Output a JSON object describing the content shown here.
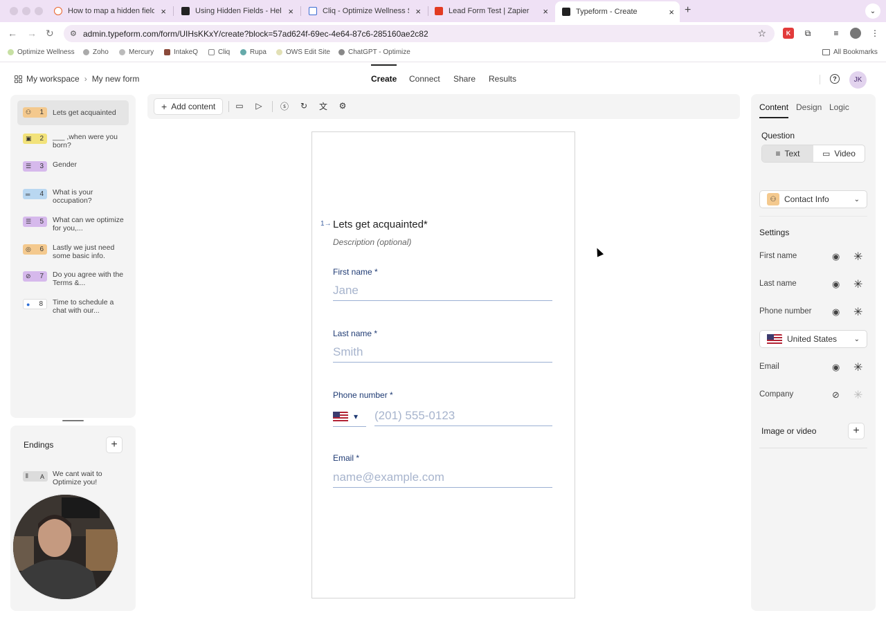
{
  "browser": {
    "tabs": [
      {
        "title": "How to map a hidden field in",
        "color": "#e8632b"
      },
      {
        "title": "Using Hidden Fields - Help Ce",
        "color": "#222222"
      },
      {
        "title": "Cliq - Optimize Wellness Solu",
        "color": "#3a6bd1"
      },
      {
        "title": "Lead Form Test | Zapier",
        "color": "#e23b22"
      },
      {
        "title": "Typeform - Create",
        "color": "#222222"
      }
    ],
    "url": "admin.typeform.com/form/UIHsKKxY/create?block=57ad624f-69ec-4e64-87c6-285160ae2c82",
    "bookmarks": [
      "Optimize Wellness",
      "Zoho",
      "Mercury",
      "IntakeQ",
      "Cliq",
      "Rupa",
      "OWS Edit Site",
      "ChatGPT - Optimize"
    ],
    "all_bookmarks": "All Bookmarks"
  },
  "header": {
    "workspace": "My workspace",
    "form_name": "My new form",
    "nav": [
      "Create",
      "Connect",
      "Share",
      "Results"
    ],
    "avatar": "JK"
  },
  "toolbar": {
    "add_content": "Add content"
  },
  "questions": [
    {
      "num": "1",
      "text": "Lets get acquainted",
      "color": "#f4c98e",
      "icon": "contact-icon"
    },
    {
      "num": "2",
      "text": "___ ,when were you born?",
      "color": "#f2e27a",
      "icon": "calendar-icon"
    },
    {
      "num": "3",
      "text": "Gender",
      "color": "#d6b9ec",
      "icon": "list-icon"
    },
    {
      "num": "4",
      "text": "What is your occupation?",
      "color": "#b9d7f1",
      "icon": "short-text-icon"
    },
    {
      "num": "5",
      "text": "What can we optimize for you,...",
      "color": "#d6b9ec",
      "icon": "list-icon"
    },
    {
      "num": "6",
      "text": "Lastly we just need some basic info.",
      "color": "#f4c98e",
      "icon": "location-icon"
    },
    {
      "num": "7",
      "text": "Do you agree with the Terms &...",
      "color": "#d6b9ec",
      "icon": "legal-icon"
    },
    {
      "num": "8",
      "text": "Time to schedule a chat with our...",
      "color": "#ffffff",
      "icon": "radio-icon"
    }
  ],
  "endings": {
    "title": "Endings",
    "items": [
      {
        "num": "A",
        "text": "We cant wait to Optimize you!"
      }
    ]
  },
  "canvas": {
    "q_number": "1",
    "title": "Lets get acquainted*",
    "description": "Description (optional)",
    "fields": {
      "first_name": {
        "label": "First name *",
        "placeholder": "Jane"
      },
      "last_name": {
        "label": "Last name *",
        "placeholder": "Smith"
      },
      "phone": {
        "label": "Phone number *",
        "placeholder": "(201) 555-0123"
      },
      "email": {
        "label": "Email *",
        "placeholder": "name@example.com"
      }
    }
  },
  "right": {
    "tabs": [
      "Content",
      "Design",
      "Logic"
    ],
    "question_label": "Question",
    "seg": [
      "Text",
      "Video"
    ],
    "type_dropdown": "Contact Info",
    "settings_label": "Settings",
    "settings": [
      {
        "name": "First name",
        "visible": true
      },
      {
        "name": "Last name",
        "visible": true
      },
      {
        "name": "Phone number",
        "visible": true
      },
      {
        "name": "Email",
        "visible": true
      },
      {
        "name": "Company",
        "visible": false
      }
    ],
    "country": "United States",
    "image_or_video": "Image or video"
  }
}
